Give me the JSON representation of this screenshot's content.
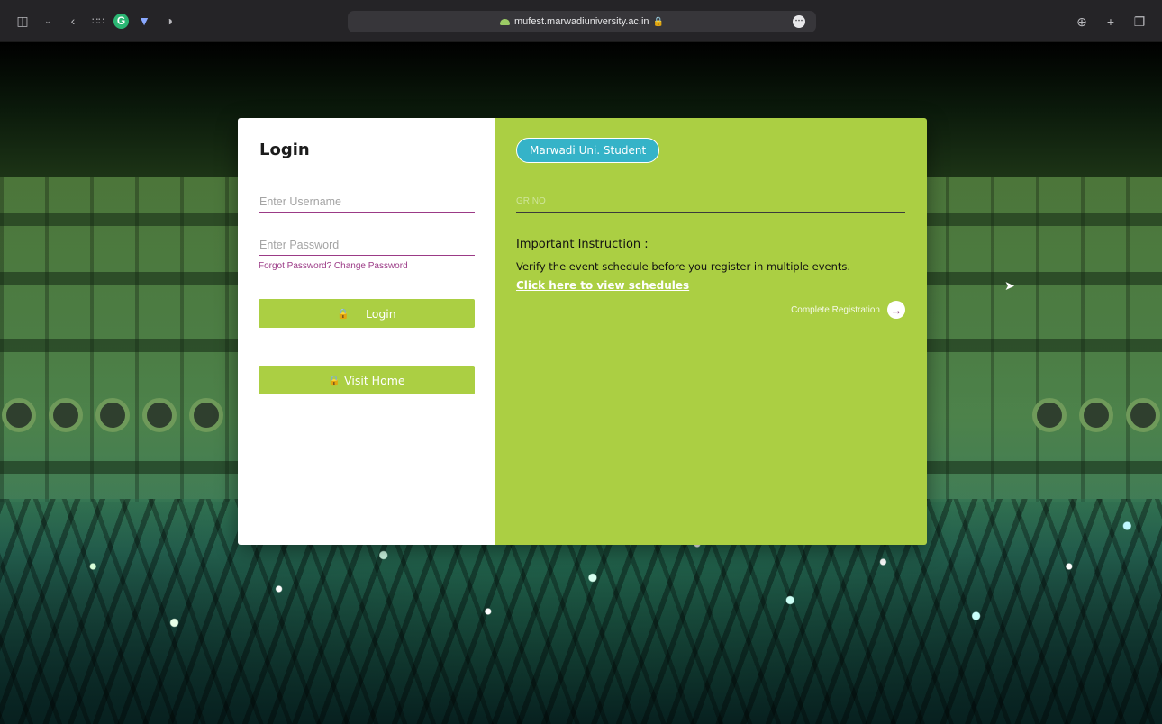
{
  "browser": {
    "url": "mufest.marwadiuniversity.ac.in",
    "icons": [
      "sidebar-icon",
      "chevron-down-icon",
      "back-icon",
      "grid-icon",
      "grammarly-icon",
      "shield-icon",
      "privacy-icon",
      "lock-icon",
      "more-icon",
      "download-icon",
      "new-tab-icon",
      "tabs-icon"
    ]
  },
  "login": {
    "title": "Login",
    "username_placeholder": "Enter Username",
    "password_placeholder": "Enter Password",
    "forgot_link": "Forgot Password? Change Password",
    "login_button": "Login",
    "home_button": "Visit Home"
  },
  "registration": {
    "student_pill": "Marwadi Uni. Student",
    "grno_placeholder": "GR NO",
    "instruction_title": "Important Instruction :",
    "instruction_text": "Verify the event schedule before you register in multiple events.",
    "schedule_link": "Click here to view schedules",
    "complete_label": "Complete Registration"
  },
  "colors": {
    "accent_green": "#abcf43",
    "accent_purple": "#9b3a86",
    "pill_teal": "#35b3c8"
  }
}
